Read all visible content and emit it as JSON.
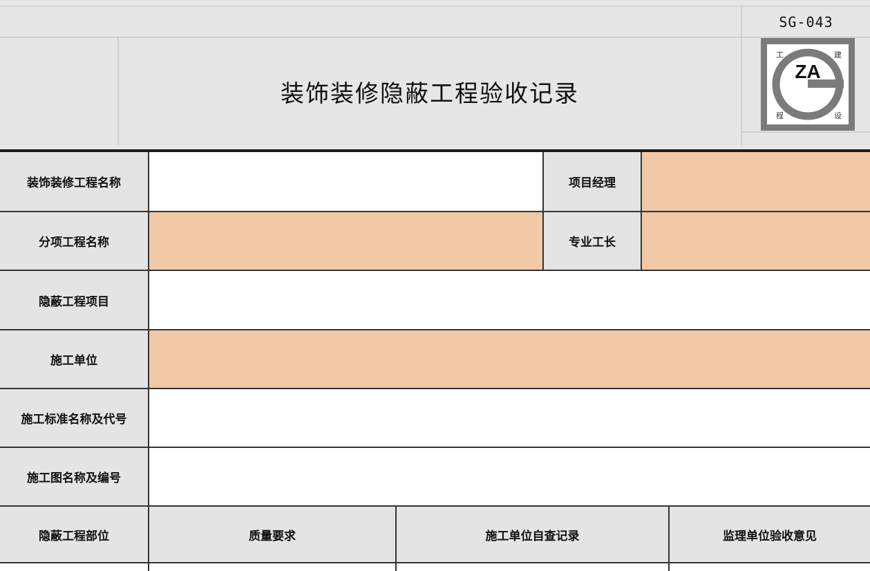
{
  "form": {
    "code": "SG-043",
    "title": "装饰装修隐蔽工程验收记录",
    "logo": {
      "initials": "ZA",
      "corner_chars": [
        "工",
        "建",
        "程",
        "设"
      ]
    }
  },
  "rows": {
    "project_name_label": "装饰装修工程名称",
    "project_manager_label": "项目经理",
    "sub_project_label": "分项工程名称",
    "foreman_label": "专业工长",
    "hidden_item_label": "隐蔽工程项目",
    "contractor_label": "施工单位",
    "standard_label": "施工标准名称及代号",
    "drawing_label": "施工图名称及编号"
  },
  "columns": {
    "location": "隐蔽工程部位",
    "quality": "质量要求",
    "self_check": "施工单位自查记录",
    "supervision": "监理单位验收意见"
  },
  "colors": {
    "label_fill": "#e4e4e4",
    "input_fill": "#f1c8a5",
    "grid": "#333333"
  }
}
